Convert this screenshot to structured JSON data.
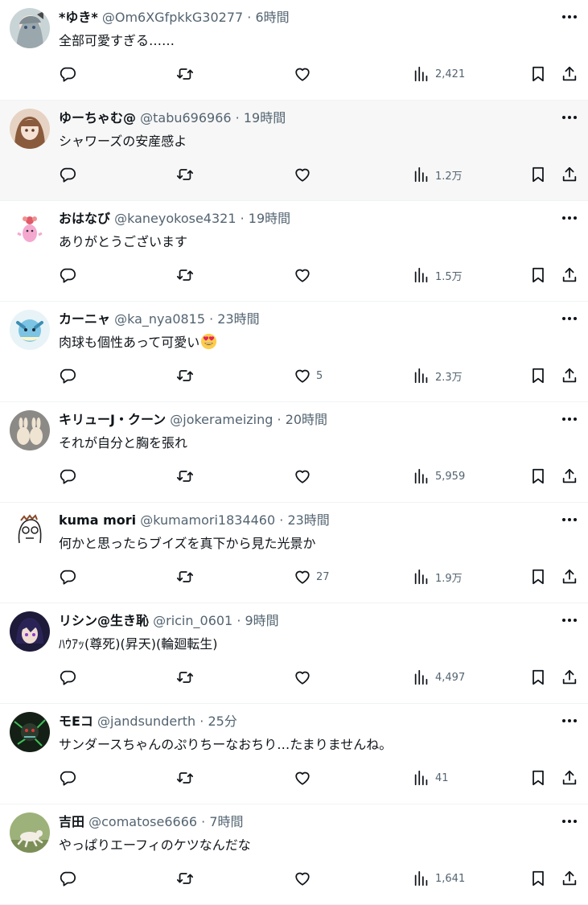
{
  "tweets": [
    {
      "name": "*ゆき*",
      "handle": "@Om6XGfpkkG30277",
      "time": "6時間",
      "text": "全部可愛すぎる……",
      "likes": "",
      "views": "2,421",
      "avatar": "anime-girl-gray"
    },
    {
      "name": "ゆーちゃむ@",
      "handle": "@tabu696966",
      "time": "19時間",
      "text": "シャワーズの安産感よ",
      "likes": "",
      "views": "1.2万",
      "avatar": "anime-girl-brown"
    },
    {
      "name": "おはなび",
      "handle": "@kaneyokose4321",
      "time": "19時間",
      "text": "ありがとうございます",
      "likes": "",
      "views": "1.5万",
      "avatar": "pink-character"
    },
    {
      "name": "カーニャ",
      "handle": "@ka_nya0815",
      "time": "23時間",
      "text": "肉球も個性あって可愛い",
      "emoji": "heart-eyes-emoji",
      "likes": "5",
      "views": "2.3万",
      "avatar": "vaporeon"
    },
    {
      "name": "キリューJ・クーン",
      "handle": "@jokerameizing",
      "time": "20時間",
      "text": "それが自分と胸を張れ",
      "likes": "",
      "views": "5,959",
      "avatar": "plush-rabbits"
    },
    {
      "name": "kuma mori",
      "handle": "@kumamori1834460",
      "time": "23時間",
      "text": "何かと思ったらブイズを真下から見た光景か",
      "likes": "27",
      "views": "1.9万",
      "avatar": "meme-face"
    },
    {
      "name": "リシン@生き恥",
      "handle": "@ricin_0601",
      "time": "9時間",
      "text": "ﾊｳｱｯ(尊死)(昇天)(輪廻転生)",
      "likes": "",
      "views": "4,497",
      "avatar": "anime-boy-purple"
    },
    {
      "name": "モEコ",
      "handle": "@jandsunderth",
      "time": "25分",
      "text": "サンダースちゃんのぷりちーなおちり…たまりませんね。",
      "likes": "",
      "views": "41",
      "avatar": "dark-creature"
    },
    {
      "name": "吉田",
      "handle": "@comatose6666",
      "time": "7時間",
      "text": "やっぱりエーフィのケツなんだな",
      "likes": "",
      "views": "1,641",
      "avatar": "dog-running"
    }
  ],
  "separator": " · ",
  "colors": {
    "text": "#0f1419",
    "secondary": "#536471",
    "divider": "#eff3f4",
    "hover": "#f7f7f7"
  },
  "icons": {
    "reply": "reply-icon",
    "retweet": "retweet-icon",
    "like": "like-icon",
    "views": "views-icon",
    "bookmark": "bookmark-icon",
    "share": "share-icon",
    "more": "more-icon"
  }
}
